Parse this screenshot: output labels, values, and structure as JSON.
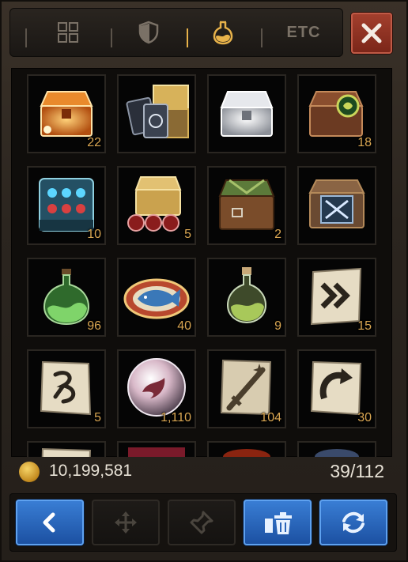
{
  "tabs": [
    {
      "name": "grid-icon"
    },
    {
      "name": "shield-icon"
    },
    {
      "name": "potion-icon",
      "active": true
    },
    {
      "label": "ETC"
    }
  ],
  "close_icon": "close-icon",
  "items": [
    {
      "name": "orange-chest",
      "qty": "22"
    },
    {
      "name": "card-chest",
      "qty": ""
    },
    {
      "name": "silver-chest",
      "qty": ""
    },
    {
      "name": "emblem-chest",
      "qty": "18"
    },
    {
      "name": "gem-cabinet",
      "qty": "10"
    },
    {
      "name": "gold-chest-orbs",
      "qty": "5"
    },
    {
      "name": "wooden-chest",
      "qty": "2"
    },
    {
      "name": "crossed-swords-chest",
      "qty": ""
    },
    {
      "name": "green-potion-large",
      "qty": "96"
    },
    {
      "name": "fish-dish",
      "qty": "40"
    },
    {
      "name": "green-potion-small",
      "qty": "9"
    },
    {
      "name": "arrow-scroll",
      "qty": "15"
    },
    {
      "name": "rune-scroll",
      "qty": "5"
    },
    {
      "name": "dragon-orb",
      "qty": "1,110"
    },
    {
      "name": "sword-scroll",
      "qty": "104"
    },
    {
      "name": "rotate-scroll",
      "qty": "30"
    },
    {
      "name": "partial-scroll",
      "qty": ""
    },
    {
      "name": "partial-red-item",
      "qty": ""
    },
    {
      "name": "partial-fire-item",
      "qty": ""
    },
    {
      "name": "partial-blue-item",
      "qty": ""
    }
  ],
  "footer": {
    "gold": "10,199,581",
    "capacity": "39/112"
  },
  "buttons": [
    {
      "name": "back-button",
      "icon": "chevron-left-icon",
      "enabled": true
    },
    {
      "name": "move-button",
      "icon": "move-icon",
      "enabled": false
    },
    {
      "name": "pin-button",
      "icon": "pin-icon",
      "enabled": false
    },
    {
      "name": "discard-button",
      "icon": "trash-icon",
      "enabled": true
    },
    {
      "name": "sort-button",
      "icon": "refresh-icon",
      "enabled": true
    }
  ]
}
